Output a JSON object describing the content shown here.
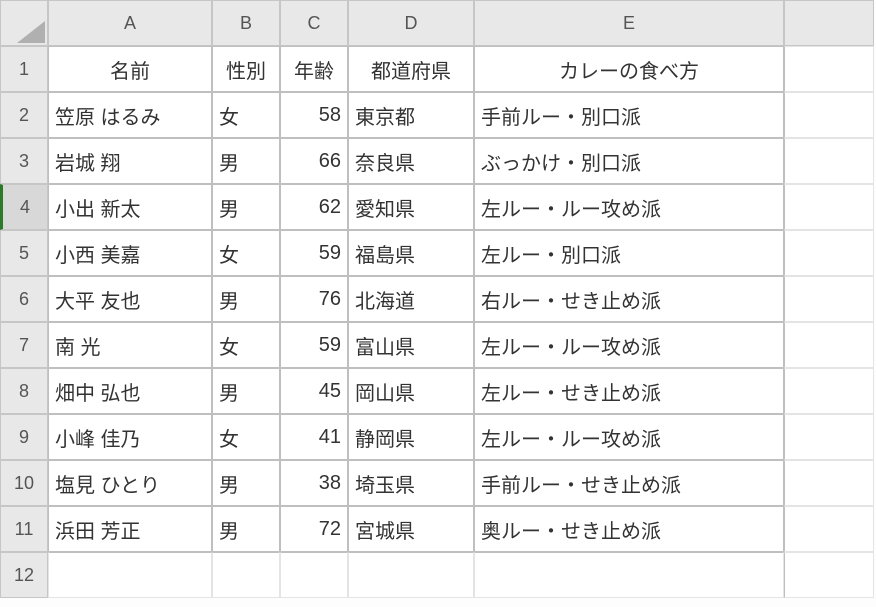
{
  "colHeaders": [
    "A",
    "B",
    "C",
    "D",
    "E",
    ""
  ],
  "rowHeaders": [
    "1",
    "2",
    "3",
    "4",
    "5",
    "6",
    "7",
    "8",
    "9",
    "10",
    "11",
    "12"
  ],
  "activeRow": 4,
  "headerRow": [
    "名前",
    "性別",
    "年齢",
    "都道府県",
    "カレーの食べ方"
  ],
  "rows": [
    {
      "name": "笠原 はるみ",
      "gender": "女",
      "age": "58",
      "pref": "東京都",
      "curry": "手前ルー・別口派"
    },
    {
      "name": "岩城 翔",
      "gender": "男",
      "age": "66",
      "pref": "奈良県",
      "curry": "ぶっかけ・別口派"
    },
    {
      "name": "小出 新太",
      "gender": "男",
      "age": "62",
      "pref": "愛知県",
      "curry": "左ルー・ルー攻め派"
    },
    {
      "name": "小西 美嘉",
      "gender": "女",
      "age": "59",
      "pref": "福島県",
      "curry": "左ルー・別口派"
    },
    {
      "name": "大平 友也",
      "gender": "男",
      "age": "76",
      "pref": "北海道",
      "curry": "右ルー・せき止め派"
    },
    {
      "name": "南 光",
      "gender": "女",
      "age": "59",
      "pref": "富山県",
      "curry": "左ルー・ルー攻め派"
    },
    {
      "name": "畑中 弘也",
      "gender": "男",
      "age": "45",
      "pref": "岡山県",
      "curry": "左ルー・せき止め派"
    },
    {
      "name": "小峰 佳乃",
      "gender": "女",
      "age": "41",
      "pref": "静岡県",
      "curry": "左ルー・ルー攻め派"
    },
    {
      "name": "塩見 ひとり",
      "gender": "男",
      "age": "38",
      "pref": "埼玉県",
      "curry": "手前ルー・せき止め派"
    },
    {
      "name": "浜田 芳正",
      "gender": "男",
      "age": "72",
      "pref": "宮城県",
      "curry": "奥ルー・せき止め派"
    }
  ]
}
